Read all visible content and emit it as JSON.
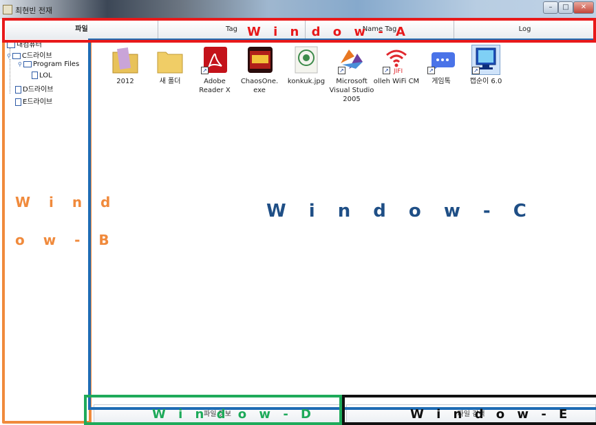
{
  "window": {
    "title": "최현빈 전재",
    "minimize": "–",
    "maximize": "□",
    "close": "✕"
  },
  "tabs": [
    {
      "label": "파일"
    },
    {
      "label": "Tag"
    },
    {
      "label": "Name Tag"
    },
    {
      "label": "Log"
    }
  ],
  "tree": {
    "root": "내컴퓨터",
    "c_drive": "C드라이브",
    "program_files": "Program Files",
    "lol": "LOL",
    "d_drive": "D드라이브",
    "e_drive": "E드라이브"
  },
  "files": [
    {
      "label": "2012",
      "icon": "folder-icon"
    },
    {
      "label": "새 폴더",
      "icon": "folder-icon"
    },
    {
      "label": "Adobe Reader X",
      "icon": "adobe-reader-icon"
    },
    {
      "label": "ChaosOne. exe",
      "icon": "chaosone-exe-icon"
    },
    {
      "label": "konkuk.jpg",
      "icon": "image-file-icon"
    },
    {
      "label": "Microsoft Visual Studio 2005",
      "icon": "visual-studio-icon"
    },
    {
      "label": "olleh WiFi CM",
      "icon": "wifi-icon"
    },
    {
      "label": "게임톡",
      "icon": "chat-icon"
    },
    {
      "label": "캡순이 6.0",
      "icon": "screen-capture-icon"
    }
  ],
  "bottom_tabs": {
    "left": "파일 정보",
    "right": "파일 검색"
  },
  "annotations": {
    "a": "W i n d o w - A",
    "b1": "W i n d",
    "b2": "o w - B",
    "c": "W i n d o w - C",
    "d": "W i n d o w - D",
    "e": "W i n d o w - E"
  },
  "colors": {
    "window_a": "#e8191a",
    "window_b": "#f08a3c",
    "window_c": "#1f6cb4",
    "window_d": "#1eaa5a",
    "window_e": "#111111"
  }
}
